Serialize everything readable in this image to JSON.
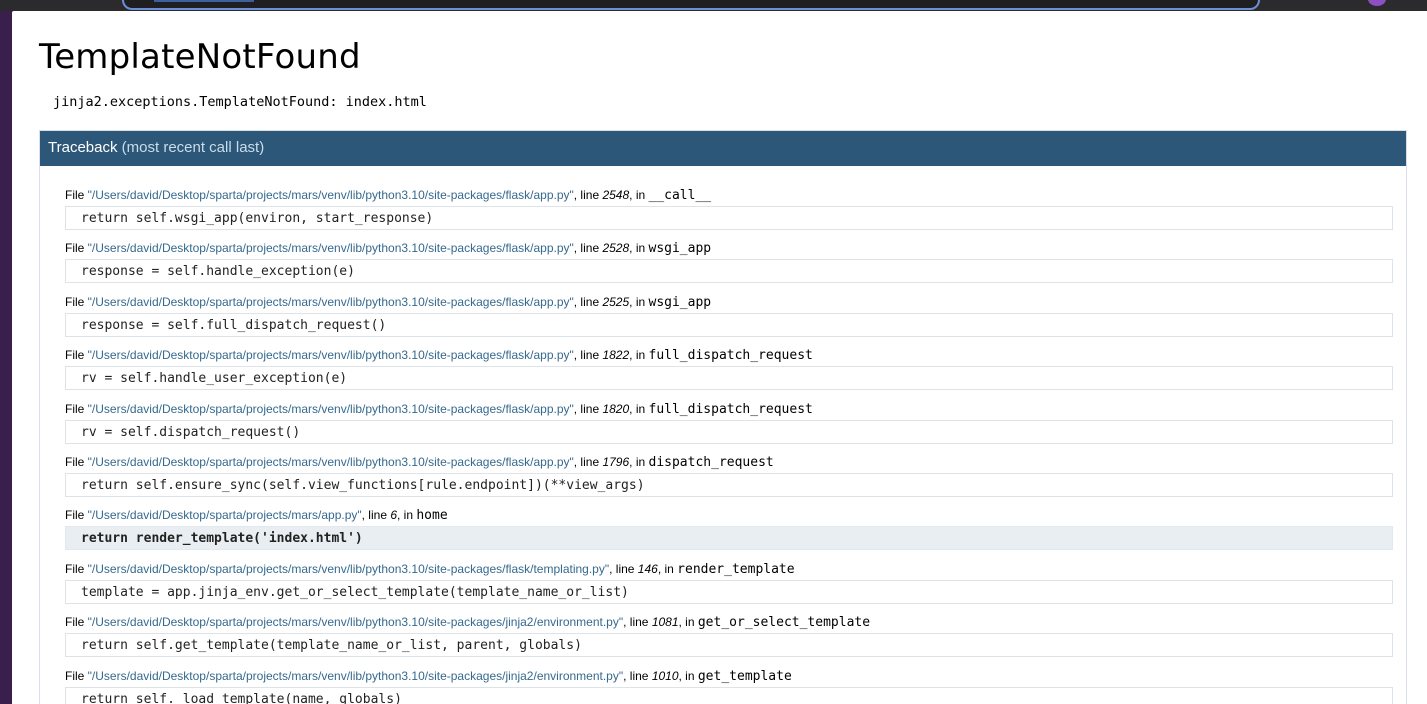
{
  "title": "TemplateNotFound",
  "error_message": "jinja2.exceptions.TemplateNotFound: index.html",
  "traceback": {
    "label": "Traceback",
    "sublabel": "(most recent call last)",
    "frames": [
      {
        "file": "\"/Users/david/Desktop/sparta/projects/mars/venv/lib/python3.10/site-packages/flask/app.py\"",
        "line": "2548",
        "func": "__call__",
        "source": "return self.wsgi_app(environ, start_response)"
      },
      {
        "file": "\"/Users/david/Desktop/sparta/projects/mars/venv/lib/python3.10/site-packages/flask/app.py\"",
        "line": "2528",
        "func": "wsgi_app",
        "source": "response = self.handle_exception(e)"
      },
      {
        "file": "\"/Users/david/Desktop/sparta/projects/mars/venv/lib/python3.10/site-packages/flask/app.py\"",
        "line": "2525",
        "func": "wsgi_app",
        "source": "response = self.full_dispatch_request()"
      },
      {
        "file": "\"/Users/david/Desktop/sparta/projects/mars/venv/lib/python3.10/site-packages/flask/app.py\"",
        "line": "1822",
        "func": "full_dispatch_request",
        "source": "rv = self.handle_user_exception(e)"
      },
      {
        "file": "\"/Users/david/Desktop/sparta/projects/mars/venv/lib/python3.10/site-packages/flask/app.py\"",
        "line": "1820",
        "func": "full_dispatch_request",
        "source": "rv = self.dispatch_request()"
      },
      {
        "file": "\"/Users/david/Desktop/sparta/projects/mars/venv/lib/python3.10/site-packages/flask/app.py\"",
        "line": "1796",
        "func": "dispatch_request",
        "source": "return self.ensure_sync(self.view_functions[rule.endpoint])(**view_args)"
      },
      {
        "file": "\"/Users/david/Desktop/sparta/projects/mars/app.py\"",
        "line": "6",
        "func": "home",
        "source": "return render_template('index.html')",
        "current": true
      },
      {
        "file": "\"/Users/david/Desktop/sparta/projects/mars/venv/lib/python3.10/site-packages/flask/templating.py\"",
        "line": "146",
        "func": "render_template",
        "source": "template = app.jinja_env.get_or_select_template(template_name_or_list)"
      },
      {
        "file": "\"/Users/david/Desktop/sparta/projects/mars/venv/lib/python3.10/site-packages/jinja2/environment.py\"",
        "line": "1081",
        "func": "get_or_select_template",
        "source": "return self.get_template(template_name_or_list, parent, globals)"
      },
      {
        "file": "\"/Users/david/Desktop/sparta/projects/mars/venv/lib/python3.10/site-packages/jinja2/environment.py\"",
        "line": "1010",
        "func": "get_template",
        "source": "return self._load_template(name, globals)"
      }
    ],
    "words": {
      "file": "File",
      "line": "line",
      "in": "in"
    }
  }
}
